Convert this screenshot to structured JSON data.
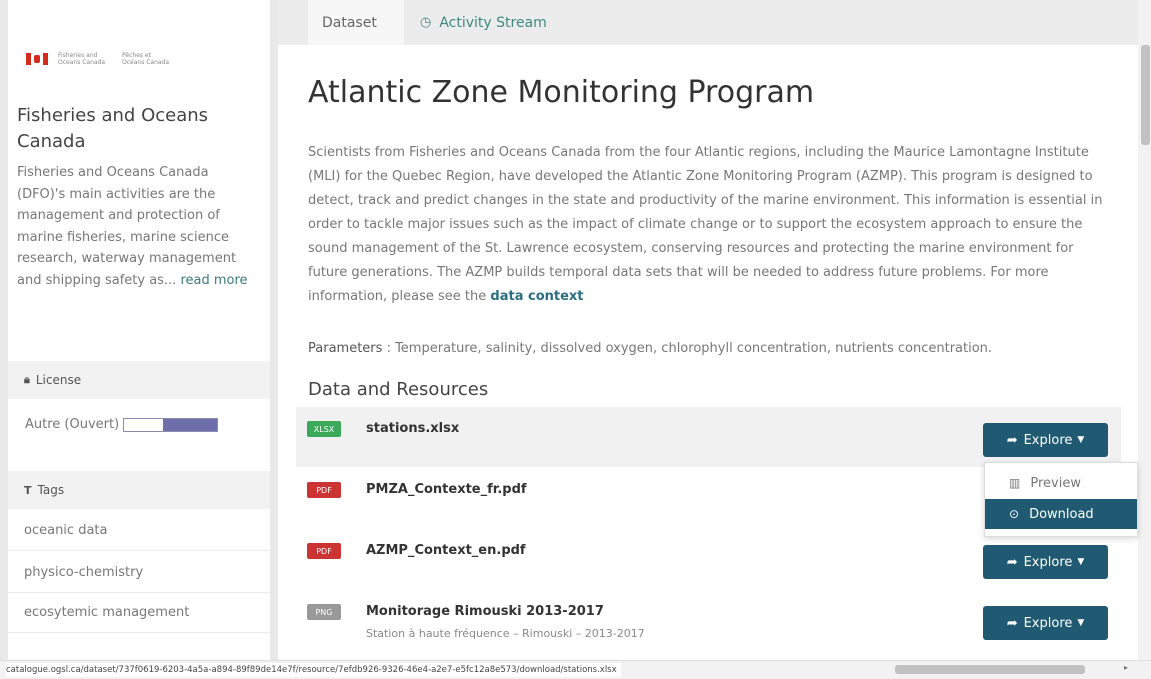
{
  "org": {
    "logo_text_left": "Fisheries and Oceans Canada",
    "logo_text_right": "Pêches et Océans Canada",
    "title": "Fisheries and Oceans Canada",
    "description": "Fisheries and Oceans Canada (DFO)'s main activities are the management and protection of marine fisheries, marine science research, waterway management and shipping safety as...",
    "read_more": "read more"
  },
  "license": {
    "heading": "License",
    "value": "Autre (Ouvert)"
  },
  "tags": {
    "heading": "Tags",
    "items": [
      "oceanic data",
      "physico-chemistry",
      "ecosytemic management"
    ]
  },
  "tabs": {
    "dataset": "Dataset",
    "activity": "Activity Stream"
  },
  "dataset": {
    "title": "Atlantic Zone Monitoring Program",
    "description": "Scientists from Fisheries and Oceans Canada from the four Atlantic regions, including the Maurice Lamontagne Institute (MLI) for the Quebec Region, have developed the Atlantic Zone Monitoring Program (AZMP). This program is designed to detect, track and predict changes in the state and productivity of the marine environment. This information is essential in order to tackle major issues such as the impact of climate change or to support the ecosystem approach to ensure the sound management of the St. Lawrence ecosystem, conserving resources and protecting the marine environment for future generations. The AZMP builds temporal data sets that will be needed to address future problems. For more information, please see the",
    "context_link": "data context",
    "params_label": "Parameters",
    "params_value": ": Temperature, salinity, dissolved oxygen, chlorophyll concentration, nutrients concentration."
  },
  "resources": {
    "heading": "Data and Resources",
    "items": [
      {
        "format": "XLSX",
        "name": "stations.xlsx",
        "sub": ""
      },
      {
        "format": "PDF",
        "name": "PMZA_Contexte_fr.pdf",
        "sub": ""
      },
      {
        "format": "PDF",
        "name": "AZMP_Context_en.pdf",
        "sub": ""
      },
      {
        "format": "PNG",
        "name": "Monitorage Rimouski 2013-2017",
        "sub": "Station à haute fréquence – Rimouski – 2013-2017"
      }
    ],
    "explore_label": "Explore"
  },
  "dropdown": {
    "preview": "Preview",
    "download": "Download"
  },
  "status": {
    "url": "catalogue.ogsl.ca/dataset/737f0619-6203-4a5a-a894-89f89de14e7f/resource/7efdb926-9326-46e4-a2e7-e5fc12a8e573/download/stations.xlsx"
  },
  "colors": {
    "primary": "#1f5a72",
    "xlsx": "#3aaa5a",
    "pdf": "#cc3333",
    "png": "#999999",
    "link": "#3e8a83"
  }
}
